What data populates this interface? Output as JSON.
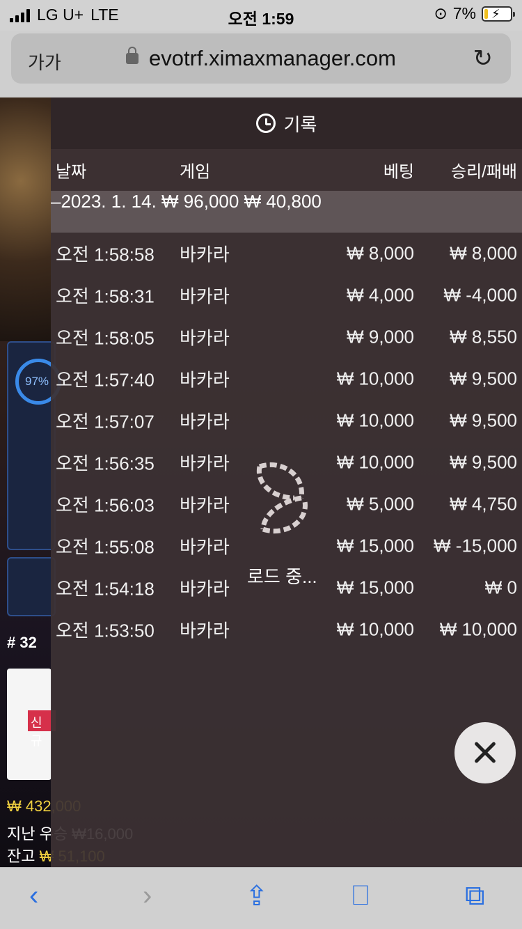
{
  "status_bar": {
    "carrier": "LG U+",
    "network": "LTE",
    "time": "오전 1:59",
    "battery": "7%"
  },
  "browser": {
    "text_size_label": "가가",
    "url": "evotrf.ximaxmanager.com"
  },
  "background": {
    "progress_label": "97%",
    "game_number": "# 32",
    "new_badge": "신규",
    "prize": "₩ 432,000",
    "last_win_label": "지난 우승 ₩16,000",
    "balance_label": "잔고",
    "balance_value": "₩ 51,100"
  },
  "history": {
    "title": "기록",
    "columns": {
      "date": "날짜",
      "game": "게임",
      "bet": "베팅",
      "win_loss": "승리/패배"
    },
    "summary": {
      "date": "–2023. 1. 14.",
      "bet": "₩ 96,000",
      "win_loss": "₩ 40,800"
    },
    "rows": [
      {
        "time": "오전 1:58:58",
        "game": "바카라",
        "bet": "₩ 8,000",
        "result": "₩ 8,000"
      },
      {
        "time": "오전 1:58:31",
        "game": "바카라",
        "bet": "₩ 4,000",
        "result": "₩ -4,000"
      },
      {
        "time": "오전 1:58:05",
        "game": "바카라",
        "bet": "₩ 9,000",
        "result": "₩ 8,550"
      },
      {
        "time": "오전 1:57:40",
        "game": "바카라",
        "bet": "₩ 10,000",
        "result": "₩ 9,500"
      },
      {
        "time": "오전 1:57:07",
        "game": "바카라",
        "bet": "₩ 10,000",
        "result": "₩ 9,500"
      },
      {
        "time": "오전 1:56:35",
        "game": "바카라",
        "bet": "₩ 10,000",
        "result": "₩ 9,500"
      },
      {
        "time": "오전 1:56:03",
        "game": "바카라",
        "bet": "₩ 5,000",
        "result": "₩ 4,750"
      },
      {
        "time": "오전 1:55:08",
        "game": "바카라",
        "bet": "₩ 15,000",
        "result": "₩ -15,000"
      },
      {
        "time": "오전 1:54:18",
        "game": "바카라",
        "bet": "₩ 15,000",
        "result": "₩ 0"
      },
      {
        "time": "오전 1:53:50",
        "game": "바카라",
        "bet": "₩ 10,000",
        "result": "₩ 10,000"
      }
    ],
    "loading_text": "로드 중..."
  },
  "colors": {
    "accent": "#2a6fe0",
    "overlay": "#3c3234"
  }
}
